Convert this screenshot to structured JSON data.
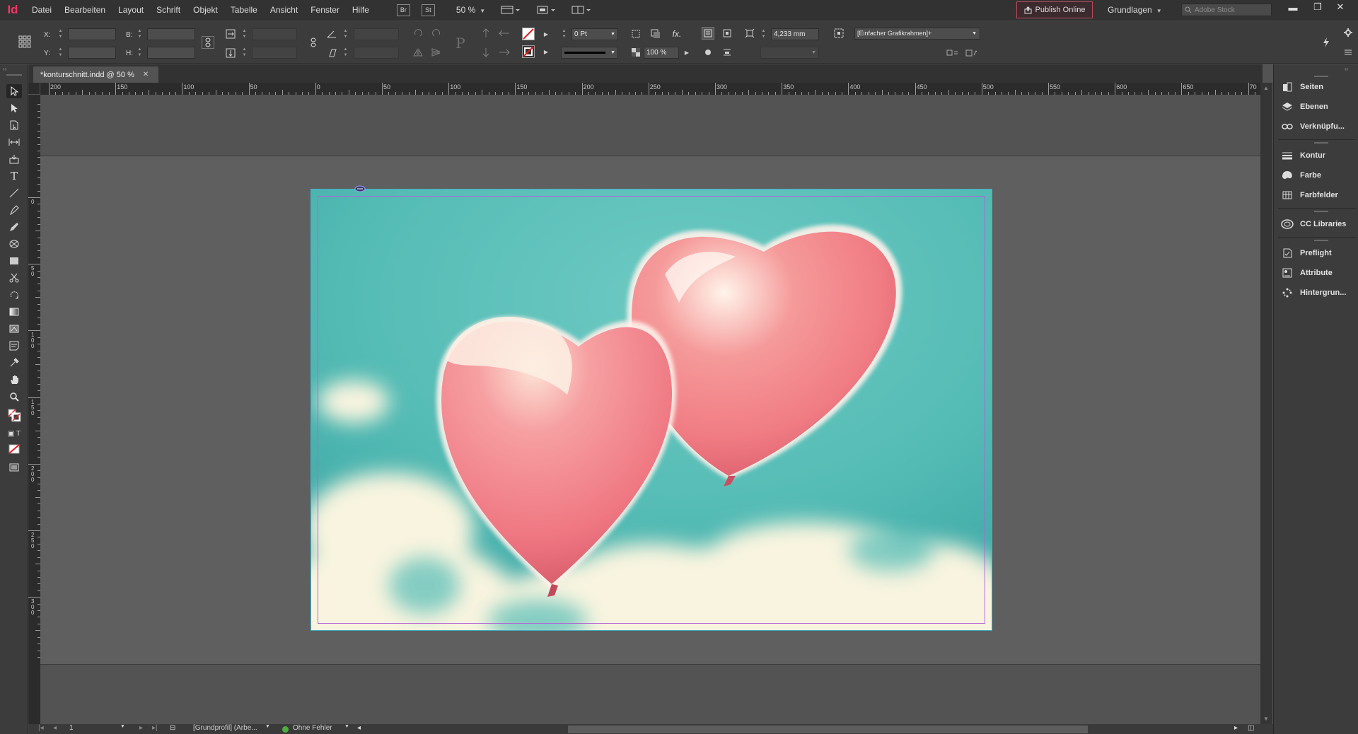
{
  "app": {
    "logo": "Id",
    "menu": [
      "Datei",
      "Bearbeiten",
      "Layout",
      "Schrift",
      "Objekt",
      "Tabelle",
      "Ansicht",
      "Fenster",
      "Hilfe"
    ],
    "bridge_label": "Br",
    "stock_label": "St",
    "zoom": "50 %",
    "publish_label": "Publish Online",
    "workspace": "Grundlagen",
    "stock_search_placeholder": "Adobe Stock"
  },
  "control_panel": {
    "x_label": "X:",
    "y_label": "Y:",
    "w_label": "B:",
    "h_label": "H:",
    "stroke_weight": "0 Pt",
    "opacity": "100 %",
    "offset": "4,233 mm",
    "object_style": "[Einfacher Grafikrahmen]+"
  },
  "document": {
    "tab_title": "*konturschnitt.indd @ 50 %",
    "h_ruler_labels": [
      "200",
      "150",
      "100",
      "50",
      "0",
      "50",
      "100",
      "150",
      "200",
      "250",
      "300",
      "350",
      "400",
      "450",
      "500",
      "550",
      "600",
      "650",
      "70"
    ],
    "v_ruler_labels": [
      "0",
      "50",
      "100",
      "150",
      "200",
      "250",
      "300"
    ]
  },
  "status": {
    "page": "1",
    "profile": "[Grundprofil] (Arbe...",
    "preflight": "Ohne Fehler"
  },
  "panels": [
    {
      "label": "Seiten",
      "icon": "pages-icon"
    },
    {
      "label": "Ebenen",
      "icon": "layers-icon"
    },
    {
      "label": "Verknüpfu...",
      "icon": "links-icon"
    },
    {
      "label": "Kontur",
      "icon": "stroke-icon"
    },
    {
      "label": "Farbe",
      "icon": "color-icon"
    },
    {
      "label": "Farbfelder",
      "icon": "swatches-icon"
    },
    {
      "label": "CC Libraries",
      "icon": "cc-libraries-icon"
    },
    {
      "label": "Preflight",
      "icon": "preflight-icon"
    },
    {
      "label": "Attribute",
      "icon": "attributes-icon"
    },
    {
      "label": "Hintergrun...",
      "icon": "background-tasks-icon"
    }
  ],
  "colors": {
    "accent": "#ff3366",
    "frame": "#3fb3c8",
    "margin_guide": "#b561d8",
    "sky": "#56bdb6",
    "balloon": "#f07d84"
  }
}
